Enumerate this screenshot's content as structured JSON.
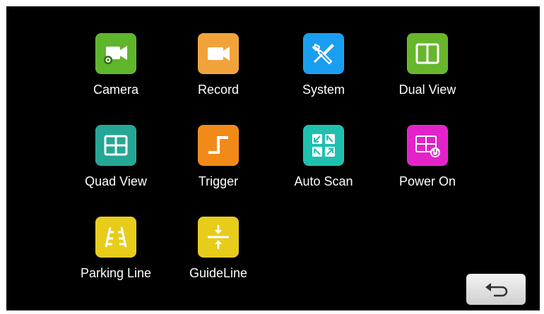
{
  "menu": {
    "items": [
      {
        "label": "Camera",
        "icon": "video-camera-gear-icon",
        "color": "#5fb52b"
      },
      {
        "label": "Record",
        "icon": "video-camera-icon",
        "color": "#f1a33b"
      },
      {
        "label": "System",
        "icon": "wrench-screwdriver-icon",
        "color": "#1a9ef0"
      },
      {
        "label": "Dual View",
        "icon": "split-screen-icon",
        "color": "#67b62c"
      },
      {
        "label": "Quad View",
        "icon": "quad-screen-icon",
        "color": "#26a695"
      },
      {
        "label": "Trigger",
        "icon": "step-signal-icon",
        "color": "#f28a1a"
      },
      {
        "label": "Auto Scan",
        "icon": "quad-arrows-icon",
        "color": "#1fc0b0"
      },
      {
        "label": "Power On",
        "icon": "grid-power-icon",
        "color": "#e323c9"
      },
      {
        "label": "Parking Line",
        "icon": "parking-line-icon",
        "color": "#e8cc1a"
      },
      {
        "label": "GuideLine",
        "icon": "guideline-arrows-icon",
        "color": "#e8cc1a"
      }
    ]
  },
  "back_button": {
    "icon": "back-arrow-icon"
  }
}
